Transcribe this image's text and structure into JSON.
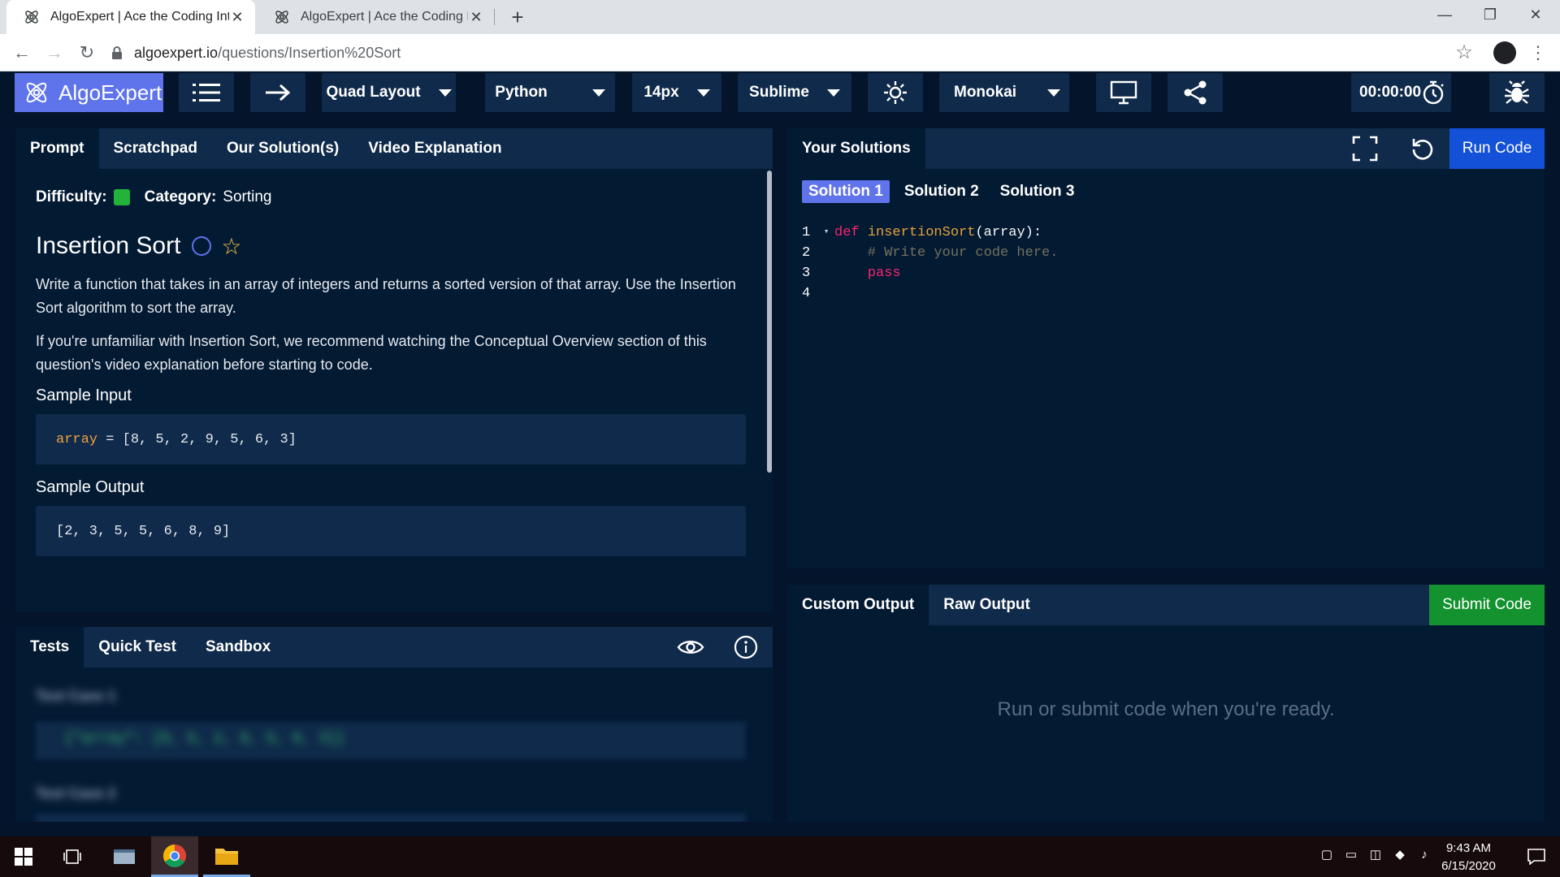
{
  "browser": {
    "tabs": [
      {
        "title": "AlgoExpert | Ace the Coding Interview",
        "close": "✕"
      },
      {
        "title": "AlgoExpert | Ace the Coding Interview",
        "close": "✕"
      }
    ],
    "new_tab": "+",
    "window": {
      "minimize": "—",
      "restore": "❐",
      "close": "✕"
    },
    "url_host": "algoexpert.io",
    "url_path": "/questions/Insertion%20Sort"
  },
  "header": {
    "logo_text": "AlgoExpert",
    "layout": "Quad Layout",
    "language": "Python",
    "font_size": "14px",
    "keymap": "Sublime",
    "theme": "Monokai",
    "timer": "00:00:00"
  },
  "prompt": {
    "tabs": [
      "Prompt",
      "Scratchpad",
      "Our Solution(s)",
      "Video Explanation"
    ],
    "difficulty_label": "Difficulty:",
    "category_label": "Category:",
    "category": "Sorting",
    "title": "Insertion Sort",
    "paragraph1": "Write a function that takes in an array of integers and returns a sorted version of that array. Use the Insertion Sort algorithm to sort the array.",
    "paragraph2": "If you're unfamiliar with Insertion Sort, we recommend watching the Conceptual Overview section of this question's video explanation before starting to code.",
    "sample_input_label": "Sample Input",
    "sample_input_var": "array",
    "sample_input_rest": " = [8, 5, 2, 9, 5, 6, 3]",
    "sample_output_label": "Sample Output",
    "sample_output": "[2, 3, 5, 5, 6, 8, 9]"
  },
  "tests": {
    "tabs": [
      "Tests",
      "Quick Test",
      "Sandbox"
    ],
    "case1": "Test Case 1",
    "case1_code": "{\"array\": [8, 5, 2, 9, 5, 6, 3]}",
    "case2": "Test Case 2"
  },
  "solutions": {
    "title": "Your Solutions",
    "run_label": "Run Code",
    "tabs": [
      "Solution 1",
      "Solution 2",
      "Solution 3"
    ],
    "code": [
      {
        "num": "1",
        "fold": "▾",
        "kw": "def ",
        "fn": "insertionSort",
        "rest": "(array):"
      },
      {
        "num": "2",
        "comment": "    # Write your code here."
      },
      {
        "num": "3",
        "kw": "    pass"
      },
      {
        "num": "4"
      }
    ]
  },
  "output": {
    "tabs": [
      "Custom Output",
      "Raw Output"
    ],
    "submit_label": "Submit Code",
    "message": "Run or submit code when you're ready."
  },
  "taskbar": {
    "time": "9:43 AM",
    "date": "6/15/2020"
  }
}
